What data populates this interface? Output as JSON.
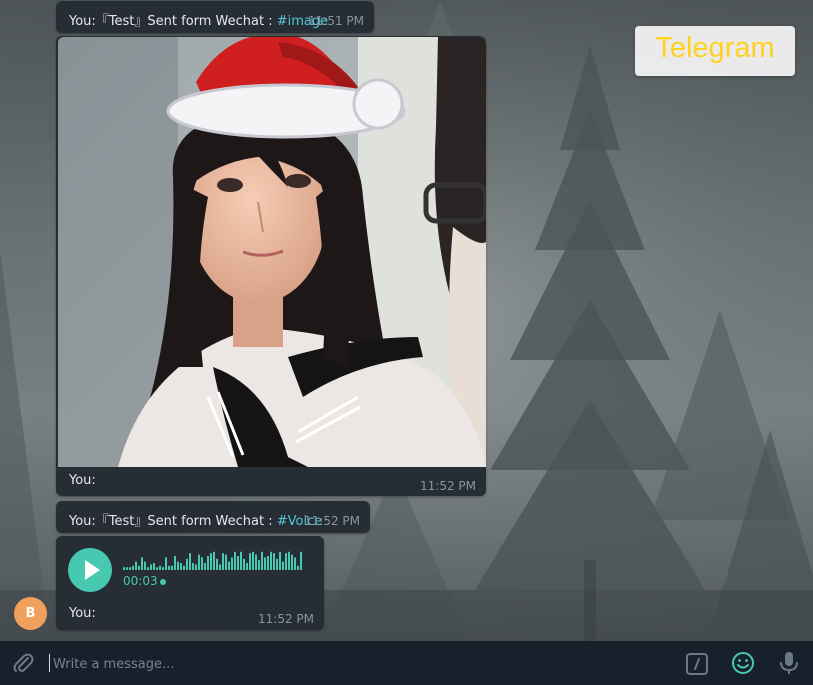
{
  "sticker": {
    "text": "Telegram"
  },
  "messages": [
    {
      "sender": "You:",
      "prefix": "『Test』Sent form Wechat : ",
      "hashtag": "#image",
      "time": "11:51 PM"
    },
    {
      "caption": "You:",
      "time": "11:52 PM"
    },
    {
      "sender": "You:",
      "prefix": "『Test』Sent form Wechat : ",
      "hashtag": "#Voice",
      "time": "11:52 PM"
    },
    {
      "duration": "00:03",
      "caption": "You:",
      "time": "11:52 PM"
    }
  ],
  "avatar": {
    "letter": "B",
    "color": "#f0a05a"
  },
  "composer": {
    "placeholder": "Write a message..."
  },
  "colors": {
    "bubble": "#262d35",
    "accent": "#46c9b0",
    "hashtag": "#54c8d6",
    "composer": "#17212b",
    "sticker_text": "#ffd21f"
  },
  "icons": [
    "paperclip-icon",
    "slash-command-icon",
    "emoji-icon",
    "microphone-icon",
    "play-icon",
    "santa-hat-icon"
  ]
}
